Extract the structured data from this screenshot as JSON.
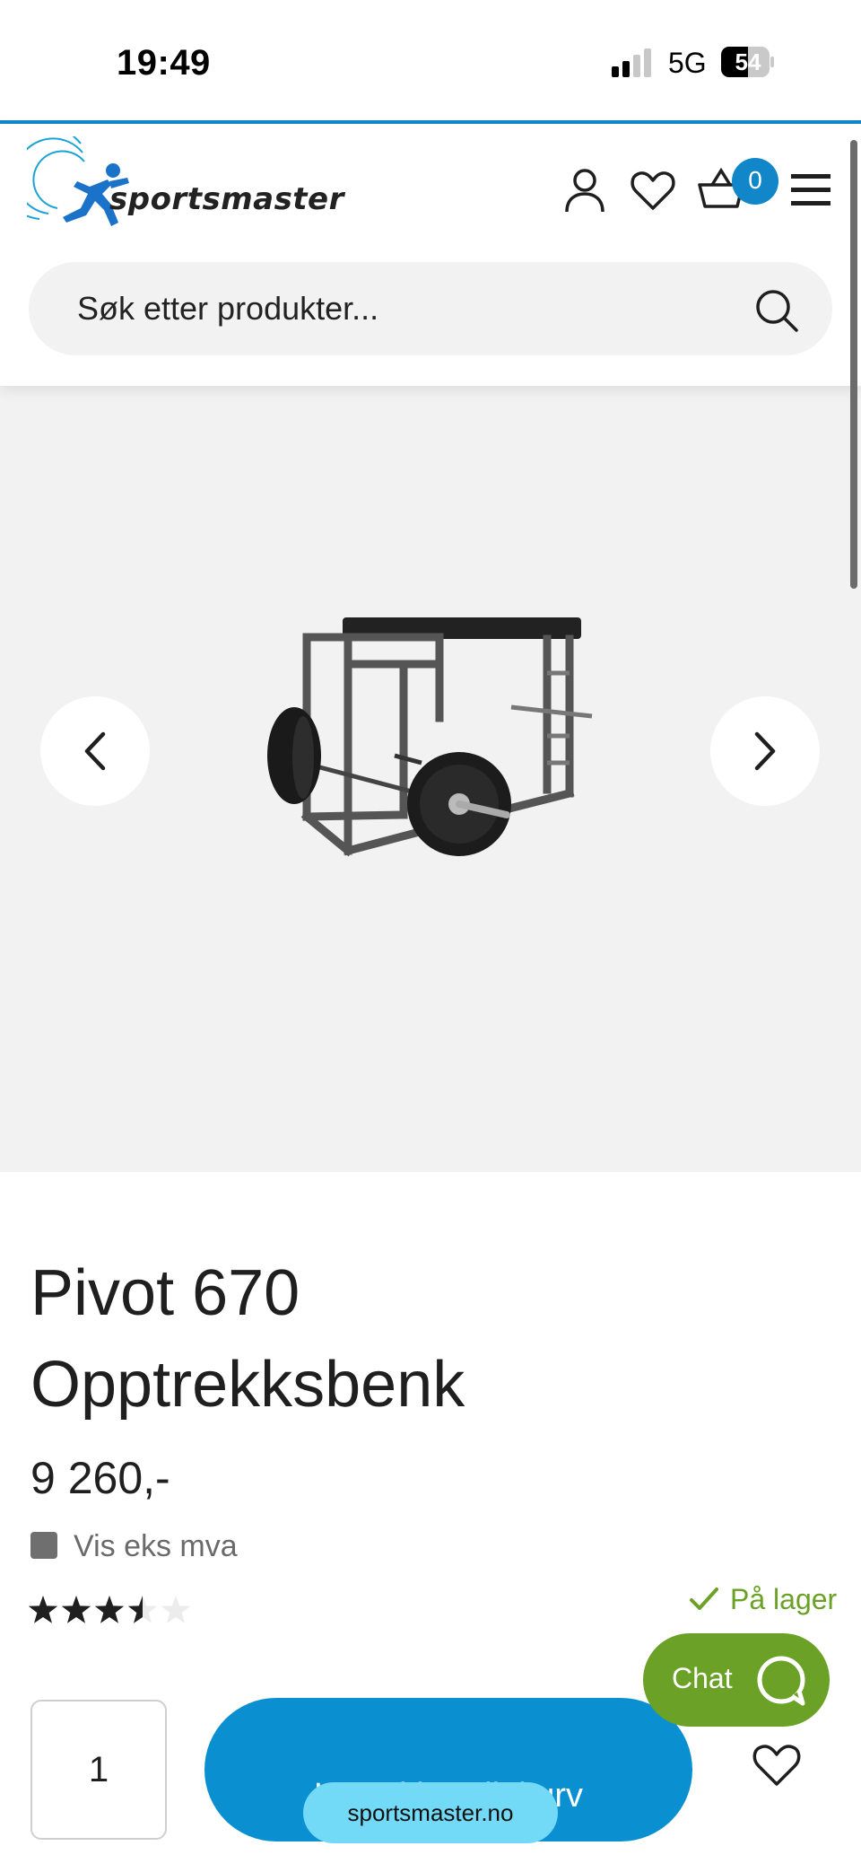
{
  "status_bar": {
    "time": "19:49",
    "network": "5G",
    "battery": "54"
  },
  "header": {
    "logo_text": "sportsmaster",
    "cart_count": "0",
    "search": {
      "placeholder": "Søk etter produkter..."
    },
    "icons": [
      "account-icon",
      "heart-icon",
      "basket-icon",
      "menu-icon",
      "search-icon"
    ]
  },
  "gallery": {
    "prev_icon": "chevron-left-icon",
    "next_icon": "chevron-right-icon"
  },
  "product": {
    "title_line1": "Pivot 670",
    "title_line2": "Opptrekksbenk",
    "price": "9 260,-",
    "vat_label": "Vis eks mva",
    "rating": 3.5,
    "rating_max": 5,
    "stock": "På lager"
  },
  "chat": {
    "label": "Chat"
  },
  "purchase": {
    "quantity": "1",
    "add_to_cart": "Legg i handlekurv"
  },
  "browser": {
    "url": "sportsmaster.no"
  },
  "colors": {
    "brand_blue": "#1187c9",
    "button_blue": "#0a8fd1",
    "stock_green": "#6aa126",
    "url_pill": "#72d9f7"
  }
}
